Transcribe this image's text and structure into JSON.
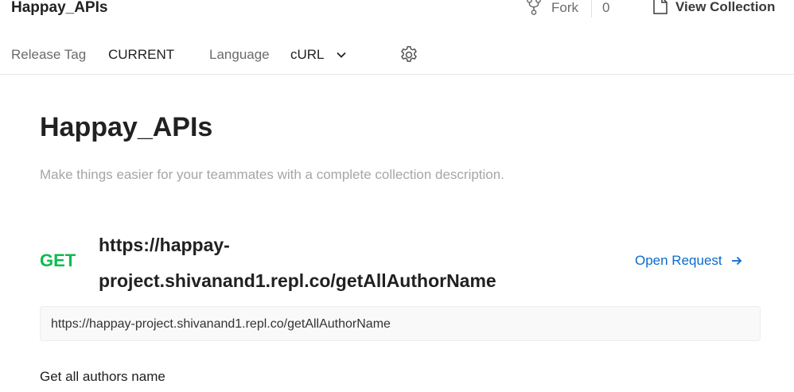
{
  "header": {
    "title": "Happay_APIs",
    "fork_label": "Fork",
    "fork_count": "0",
    "view_collection_label": "View Collection"
  },
  "settings": {
    "release_tag_label": "Release Tag",
    "release_tag_value": "CURRENT",
    "language_label": "Language",
    "language_value": "cURL"
  },
  "collection": {
    "title": "Happay_APIs",
    "description_placeholder": "Make things easier for your teammates with a complete collection description."
  },
  "request": {
    "method": "GET",
    "name": "https://happay-project.shivanand1.repl.co/getAllAuthorName",
    "open_label": "Open Request",
    "url": "https://happay-project.shivanand1.repl.co/getAllAuthorName",
    "description": "Get all authors name"
  },
  "colors": {
    "get_method": "#0cbb52",
    "link": "#0b6bcb",
    "muted_text": "#6b6b6b",
    "placeholder_text": "#a6a6a6"
  },
  "icons": [
    "fork-icon",
    "document-icon",
    "chevron-down-icon",
    "gear-icon",
    "arrow-right-icon"
  ]
}
